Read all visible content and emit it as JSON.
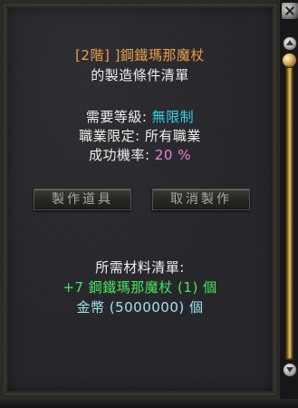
{
  "window": {
    "title_line1": "[2階] ]鋼鐵瑪那魔杖",
    "title_line2": "的製造條件清單"
  },
  "requirements": {
    "level_label": "需要等級:",
    "level_value": "無限制",
    "class_label": "職業限定:",
    "class_value": "所有職業",
    "rate_label": "成功機率:",
    "rate_value": "20 %"
  },
  "buttons": {
    "make_label": "製作道具",
    "cancel_label": "取消製作"
  },
  "materials": {
    "header": "所需材料清單:",
    "items": [
      {
        "text": "+7 鋼鐵瑪那魔杖 (1) 個"
      },
      {
        "text": "金幣 (5000000) 個"
      }
    ]
  },
  "colors": {
    "title": "#e9a04a",
    "value_cyan": "#35d0e6",
    "rate_pink": "#e383d8",
    "material_green": "#46e85e",
    "gold_aqua": "#9de4ef"
  },
  "icons": {
    "close": "close-icon",
    "scroll_up": "scroll-up-arrow-icon",
    "scroll_down": "scroll-down-arrow-icon",
    "scroll_thumb": "scroll-thumb-icon"
  }
}
